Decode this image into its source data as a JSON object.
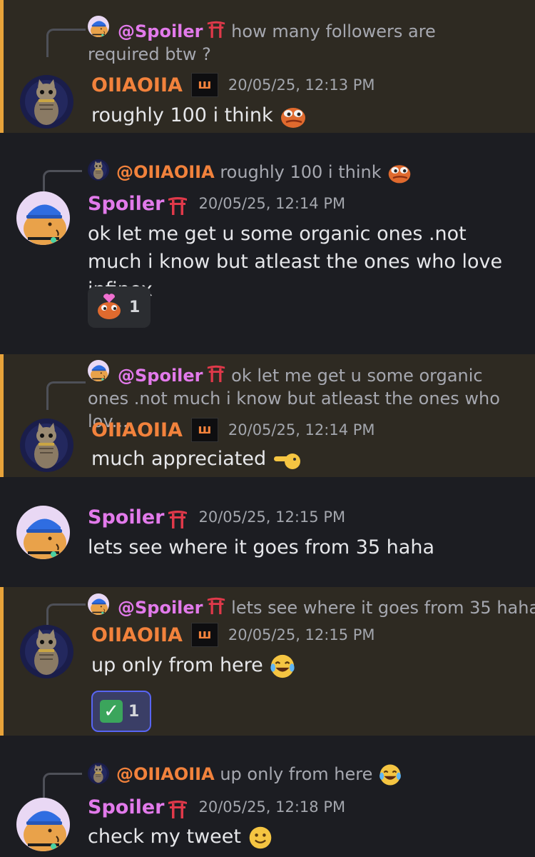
{
  "messages": [
    {
      "reply": {
        "mention": "@Spoiler",
        "text": "how many followers are required btw ?"
      },
      "username": "OIIAOIIA",
      "badge": "ш",
      "timestamp": "20/05/25, 12:13 PM",
      "text": "roughly 100 i think"
    },
    {
      "reply": {
        "mention": "@OIIAOIIA",
        "text": "roughly 100 i think"
      },
      "username": "Spoiler",
      "timestamp": "20/05/25, 12:14 PM",
      "text": "ok let me get u some organic ones .not much i know but atleast the ones who love infinex",
      "reaction": {
        "count": "1",
        "icon": "pepe-heart-icon"
      }
    },
    {
      "reply": {
        "mention": "@Spoiler",
        "text": "ok let me get u some organic ones .not much i know but atleast the ones who lov..."
      },
      "username": "OIIAOIIA",
      "badge": "ш",
      "timestamp": "20/05/25, 12:14 PM",
      "text": "much appreciated"
    },
    {
      "username": "Spoiler",
      "timestamp": "20/05/25, 12:15 PM",
      "text": "lets see where it goes from 35 haha"
    },
    {
      "reply": {
        "mention": "@Spoiler",
        "text": "lets see where it goes from 35 haha"
      },
      "username": "OIIAOIIA",
      "badge": "ш",
      "timestamp": "20/05/25, 12:15 PM",
      "text": "up only from here",
      "reaction": {
        "count": "1",
        "icon": "check-mark-icon",
        "glyph": "✓"
      }
    },
    {
      "reply": {
        "mention": "@OIIAOIIA",
        "text": "up only from here"
      },
      "username": "Spoiler",
      "timestamp": "20/05/25, 12:18 PM",
      "text": "check my tweet"
    }
  ],
  "colors": {
    "background": "#1c1d22",
    "highlight_background": "#2e2a22",
    "highlight_border": "#e8a33a",
    "orange_name": "#f2823c",
    "pink_name": "#e27aeb"
  }
}
